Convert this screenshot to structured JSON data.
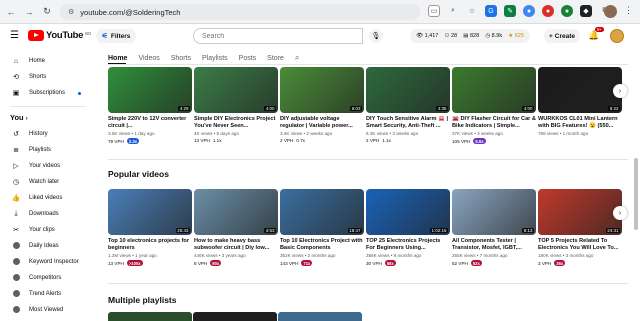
{
  "browser": {
    "url": "youtube.com/@SolderingTech"
  },
  "header": {
    "logo_text": "YouTube",
    "region": "BD",
    "filters_label": "Filters",
    "search_placeholder": "Search",
    "stats": {
      "a": "1,417",
      "b": "28",
      "c": "828",
      "d": "8.9k",
      "e": "625"
    },
    "create_label": "Create",
    "notif_count": "9+"
  },
  "sidebar": {
    "items_top": [
      {
        "label": "Home",
        "icon": "home-icon"
      },
      {
        "label": "Shorts",
        "icon": "shorts-icon"
      },
      {
        "label": "Subscriptions",
        "icon": "subscriptions-icon"
      }
    ],
    "you_label": "You",
    "you_items": [
      {
        "label": "History",
        "icon": "history-icon"
      },
      {
        "label": "Playlists",
        "icon": "playlists-icon"
      },
      {
        "label": "Your videos",
        "icon": "your-videos-icon"
      },
      {
        "label": "Watch later",
        "icon": "watch-later-icon"
      },
      {
        "label": "Liked videos",
        "icon": "liked-icon"
      },
      {
        "label": "Downloads",
        "icon": "downloads-icon"
      },
      {
        "label": "Your clips",
        "icon": "clips-icon"
      }
    ],
    "ext_items": [
      {
        "label": "Daily Ideas"
      },
      {
        "label": "Keyword Inspector"
      },
      {
        "label": "Competitors"
      },
      {
        "label": "Trend Alerts"
      },
      {
        "label": "Most Viewed"
      }
    ]
  },
  "tabs": [
    "Home",
    "Videos",
    "Shorts",
    "Playlists",
    "Posts",
    "Store"
  ],
  "sections": {
    "popular_title": "Popular videos",
    "playlists_title": "Multiple playlists"
  },
  "row1": [
    {
      "title": "Simple 220V to 12V converter circuit |...",
      "meta": "3.6K views • 1 day ago",
      "vph": "79 VPH",
      "badge": "2.3x",
      "badge_color": "blue",
      "duration": "4:29",
      "thumb": "#2f8f3a"
    },
    {
      "title": "Simple DIY Electronics Project You've Never Seen...",
      "meta": "4K views • 5 days ago",
      "vph": "13 VPH",
      "badge": "1.1x",
      "badge_color": "none",
      "duration": "4:00",
      "thumb": "#3a7d46"
    },
    {
      "title": "DIY adjustable voltage regulator | Variable power...",
      "meta": "3.4K views • 2 weeks ago",
      "vph": "2 VPH",
      "badge": "0.7x",
      "badge_color": "none",
      "duration": "6:03",
      "thumb": "#4a8d38"
    },
    {
      "title": "DIY Touch Sensitive Alarm 🚨 | Smart Security, Anti-Theft ...",
      "meta": "6.3K views • 3 weeks ago",
      "vph": "2 VPH",
      "badge": "1.1x",
      "badge_color": "none",
      "duration": "4:35",
      "thumb": "#2d6a3c"
    },
    {
      "title": "🚘 DIY Flasher Circuit for Car & Bike Indicators | Simple...",
      "meta": "37K views • 3 weeks ago",
      "vph": "105 VPH",
      "badge": "5.5x",
      "badge_color": "purple",
      "duration": "4:00",
      "thumb": "#3b7a2e"
    },
    {
      "title": "WURKKOS CL01 Mini Lantern with BIG Features! 😮 (550...",
      "meta": "788 views • 1 month ago",
      "vph": "",
      "badge": "",
      "badge_color": "none",
      "duration": "8:22",
      "thumb": "#1b1b1b"
    }
  ],
  "row2": [
    {
      "title": "Top 10 electronics projects for beginners",
      "meta": "1.2M views • 1 year ago",
      "vph": "13 VPH",
      "badge": ">100x",
      "badge_color": "red",
      "duration": "25:43",
      "thumb": "#4a7fb8"
    },
    {
      "title": "How to make heavy bass subwoofer circuit | Diy low...",
      "meta": "446K views • 3 years ago",
      "vph": "8 VPH",
      "badge": "90x",
      "badge_color": "red",
      "duration": "4:53",
      "thumb": "#6a8fa8"
    },
    {
      "title": "Top 10 Electronics Project with Basic Components",
      "meta": "352K views • 2 months ago",
      "vph": "143 VPH",
      "badge": "71x",
      "badge_color": "red",
      "duration": "18:47",
      "thumb": "#3a6fa0"
    },
    {
      "title": "TOP 25 Electronics Projects For Beginners Using...",
      "meta": "286K views • 8 months ago",
      "vph": "30 VPH",
      "badge": "58x",
      "badge_color": "red",
      "duration": "1:02:16",
      "thumb": "#1a63b8"
    },
    {
      "title": "All Components Tester | Transistor, Mosfet, IGBT,...",
      "meta": "255K views • 7 months ago",
      "vph": "52 VPH",
      "badge": "52x",
      "badge_color": "red",
      "duration": "6:13",
      "thumb": "#8aa5c0"
    },
    {
      "title": "TOP 5 Projects Related To Electronics You Will Love To...",
      "meta": "180K views • 3 months ago",
      "vph": "3 VPH",
      "badge": "36x",
      "badge_color": "red",
      "duration": "24:31",
      "thumb": "#c0392b"
    }
  ]
}
